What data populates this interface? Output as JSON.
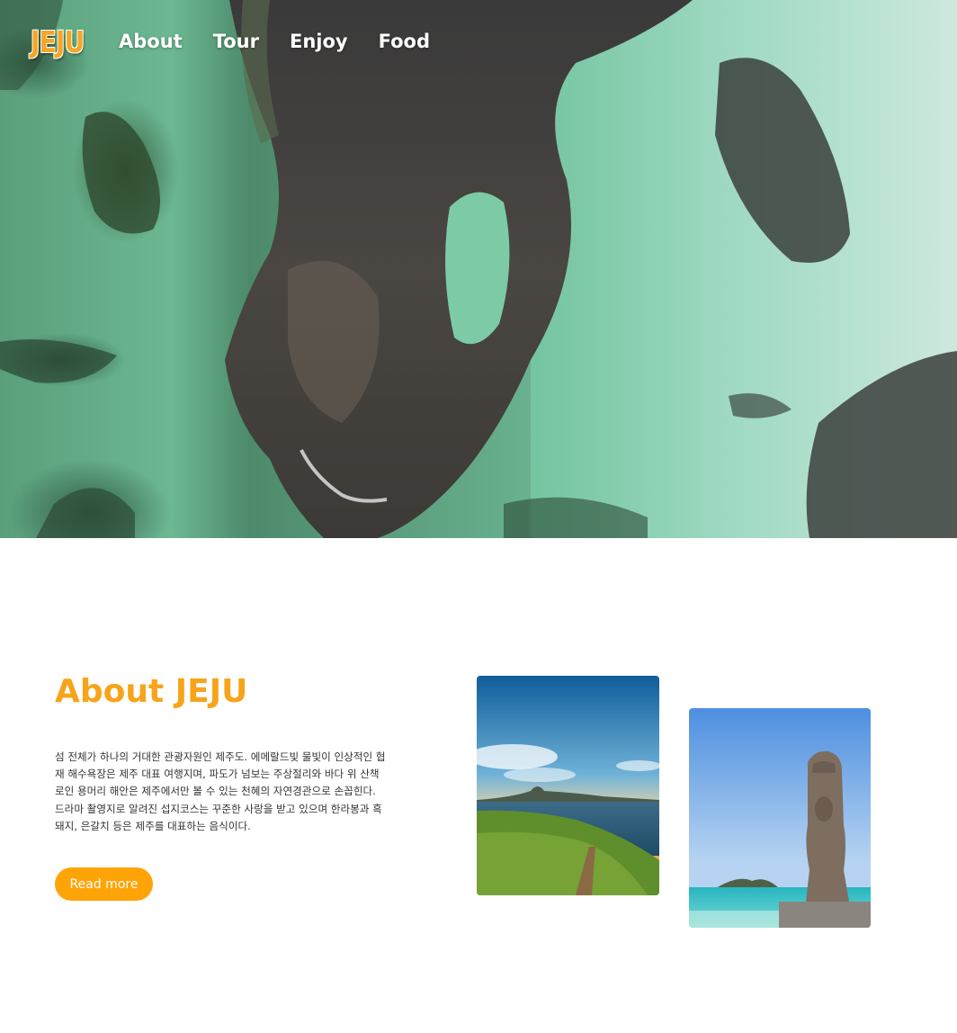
{
  "nav": {
    "logo": "JEJU",
    "links": [
      "About",
      "Tour",
      "Enjoy",
      "Food"
    ]
  },
  "hero": {
    "image_description_icon": "aerial-coast-image"
  },
  "about": {
    "title": "About JEJU",
    "body": "섬 전체가 하나의 거대한 관광자원인 제주도. 에메랄드빛 물빛이 인상적인 협재 해수욕장은 제주 대표 여행지며, 파도가 넘보는 주상절리와 바다 위 산책로인 용머리 해안은 제주에서만 볼 수 있는 천혜의 자연경관으로 손꼽힌다. 드라마 촬영지로 알려진 섭지코스는 꾸준한 사랑을 받고 있으며 한라봉과 흑돼지, 은갈치 등은 제주를 대표하는 음식이다.",
    "button_label": "Read more"
  },
  "colors": {
    "accent": "#f7a41b",
    "button": "#ffa406",
    "nav_text": "#ffffff"
  }
}
